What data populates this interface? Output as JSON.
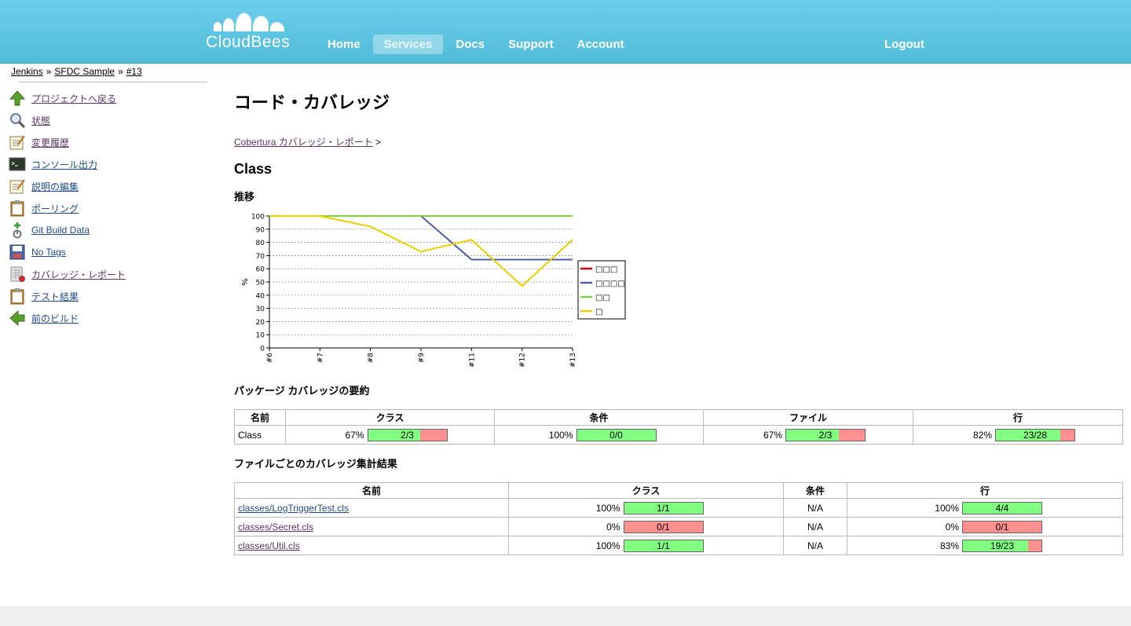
{
  "header": {
    "logo_text": "CloudBees",
    "nav": [
      {
        "label": "Home",
        "active": false
      },
      {
        "label": "Services",
        "active": true
      },
      {
        "label": "Docs",
        "active": false
      },
      {
        "label": "Support",
        "active": false
      },
      {
        "label": "Account",
        "active": false
      }
    ],
    "logout": "Logout"
  },
  "breadcrumb": [
    "Jenkins",
    "SFDC Sample",
    "#13"
  ],
  "breadcrumb_sep": "»",
  "sidebar": [
    {
      "label": "プロジェクトへ戻る",
      "icon": "up-arrow-icon"
    },
    {
      "label": "状態",
      "icon": "magnifier-icon"
    },
    {
      "label": "変更履歴",
      "icon": "notepad-icon"
    },
    {
      "label": "コンソール出力",
      "icon": "terminal-icon"
    },
    {
      "label": "説明の編集",
      "icon": "notepad-icon"
    },
    {
      "label": "ポーリング",
      "icon": "clipboard-icon"
    },
    {
      "label": "Git Build Data",
      "icon": "git-icon"
    },
    {
      "label": "No Tags",
      "icon": "save-icon"
    },
    {
      "label": "カバレッジ・レポート",
      "icon": "coverage-icon"
    },
    {
      "label": "テスト結果",
      "icon": "clipboard-icon"
    },
    {
      "label": "前のビルド",
      "icon": "left-arrow-icon"
    }
  ],
  "main": {
    "title": "コード・カバレッジ",
    "sub_breadcrumb_link": "Cobertura カバレッジ・レポート",
    "sub_breadcrumb_sep": ">",
    "section": "Class",
    "trend_title": "推移",
    "package_summary_title": "パッケージ カバレッジの要約",
    "file_summary_title": "ファイルごとのカバレッジ集計結果"
  },
  "chart_data": {
    "type": "line",
    "x": [
      "#6",
      "#7",
      "#8",
      "#9",
      "#11",
      "#12",
      "#13"
    ],
    "ylabel": "%",
    "ylim": [
      0,
      100
    ],
    "yticks": [
      0,
      10,
      20,
      30,
      40,
      50,
      60,
      70,
      80,
      90,
      100
    ],
    "grid": true,
    "legend_position": "right",
    "series": [
      {
        "name": "□□□",
        "color": "#e00000",
        "values": [
          100,
          100,
          100,
          100,
          100,
          100,
          100
        ]
      },
      {
        "name": "□□□□",
        "color": "#5060a8",
        "values": [
          100,
          100,
          100,
          100,
          67,
          67,
          67
        ]
      },
      {
        "name": "□□",
        "color": "#80d040",
        "values": [
          100,
          100,
          100,
          100,
          100,
          100,
          100
        ]
      },
      {
        "name": "□",
        "color": "#e8d000",
        "values": [
          100,
          100,
          92,
          73,
          82,
          47,
          82
        ]
      }
    ]
  },
  "package_table": {
    "headers": [
      "名前",
      "クラス",
      "条件",
      "ファイル",
      "行"
    ],
    "rows": [
      {
        "name": "Class",
        "cells": [
          {
            "pct": "67%",
            "label": "2/3",
            "ratio": 0.667
          },
          {
            "pct": "100%",
            "label": "0/0",
            "ratio": 1.0
          },
          {
            "pct": "67%",
            "label": "2/3",
            "ratio": 0.667
          },
          {
            "pct": "82%",
            "label": "23/28",
            "ratio": 0.821
          }
        ]
      }
    ]
  },
  "file_table": {
    "headers": [
      "名前",
      "クラス",
      "条件",
      "行"
    ],
    "rows": [
      {
        "name": "classes/LogTriggerTest.cls",
        "class_pct": "100%",
        "class_label": "1/1",
        "class_ratio": 1.0,
        "cond": "N/A",
        "line_pct": "100%",
        "line_label": "4/4",
        "line_ratio": 1.0
      },
      {
        "name": "classes/Secret.cls",
        "class_pct": "0%",
        "class_label": "0/1",
        "class_ratio": 0.0,
        "cond": "N/A",
        "line_pct": "0%",
        "line_label": "0/1",
        "line_ratio": 0.0
      },
      {
        "name": "classes/Util.cls",
        "class_pct": "100%",
        "class_label": "1/1",
        "class_ratio": 1.0,
        "cond": "N/A",
        "line_pct": "83%",
        "line_label": "19/23",
        "line_ratio": 0.826
      }
    ]
  }
}
